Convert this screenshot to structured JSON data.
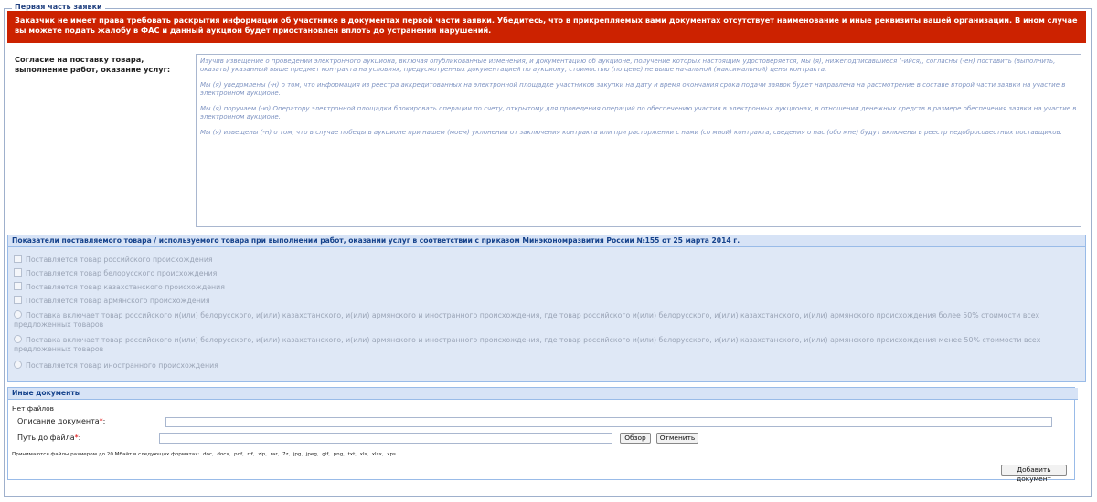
{
  "legend": "Первая часть заявки",
  "warning": "Заказчик не имеет права требовать раскрытия информации об участнике в документах первой части заявки. Убедитесь, что в прикрепляемых вами документах отсутствует наименование и иные реквизиты вашей организации. В ином случае вы можете подать жалобу в ФАС и данный аукцион будет приостановлен вплоть до устранения нарушений.",
  "agreement": {
    "label": "Согласие на поставку товара, выполнение работ, оказание услуг:",
    "paragraphs": [
      "Изучив извещение о проведении электронного аукциона, включая опубликованные изменения, и документацию об аукционе, получение которых настоящим удостоверяется, мы (я), нижеподписавшиеся (-ийся), согласны (-ен) поставить (выполнить, оказать) указанный выше предмет контракта на условиях, предусмотренных документацией по аукциону, стоимостью (по цене) не выше начальной (максимальной) цены контракта.",
      "Мы (я) уведомлены (-н) о том, что информация из реестра аккредитованных на электронной площадке участников закупки на дату и время окончания срока подачи заявок будет направлена на рассмотрение в составе второй части заявки на участие в электронном аукционе.",
      "Мы (я) поручаем (-ю) Оператору электронной площадки блокировать операции по счету, открытому для проведения операций по обеспечению участия в электронных аукционах, в отношении денежных средств в размере обеспечения заявки на участие в электронном аукционе.",
      "Мы (я) извещены (-н) о том, что в случае победы в аукционе при нашем (моем) уклонении от заключения контракта или при расторжении с нами (со мной) контракта, сведения о нас (обо мне) будут включены в реестр недобросовестных поставщиков."
    ]
  },
  "indicators": {
    "header": "Показатели поставляемого товара / используемого товара при выполнении работ, оказании услуг в соответствии с приказом Минэкономразвития России №155 от 25 марта 2014 г.",
    "options": [
      {
        "type": "checkbox",
        "label": "Поставляется товар российского происхождения"
      },
      {
        "type": "checkbox",
        "label": "Поставляется товар белорусского происхождения"
      },
      {
        "type": "checkbox",
        "label": "Поставляется товар казахстанского происхождения"
      },
      {
        "type": "checkbox",
        "label": "Поставляется товар армянского происхождения"
      },
      {
        "type": "radio",
        "label": "Поставка включает товар российского и(или) белорусского, и(или) казахстанского, и(или) армянского и иностранного происхождения, где товар российского и(или) белорусского, и(или) казахстанского, и(или) армянского происхождения более 50% стоимости всех предложенных товаров"
      },
      {
        "type": "radio",
        "label": "Поставка включает товар российского и(или) белорусского, и(или) казахстанского, и(или) армянского и иностранного происхождения, где товар российского и(или) белорусского, и(или) казахстанского, и(или) армянского происхождения менее 50% стоимости всех предложенных товаров"
      },
      {
        "type": "radio",
        "label": "Поставляется товар иностранного происхождения"
      }
    ]
  },
  "docs": {
    "header": "Иные документы",
    "no_files": "Нет файлов",
    "desc_label": "Описание документа",
    "path_label": "Путь до файла",
    "browse": "Обзор",
    "cancel": "Отменить",
    "hint": "Принимаются файлы размером до 20 Мбайт в следующих форматах: .doc, .docx, .pdf, .rtf, .zip, .rar, .7z, .jpg, .jpeg, .gif, .png, .txt, .xls, .xlsx, .xps",
    "add": "Добавить документ"
  }
}
